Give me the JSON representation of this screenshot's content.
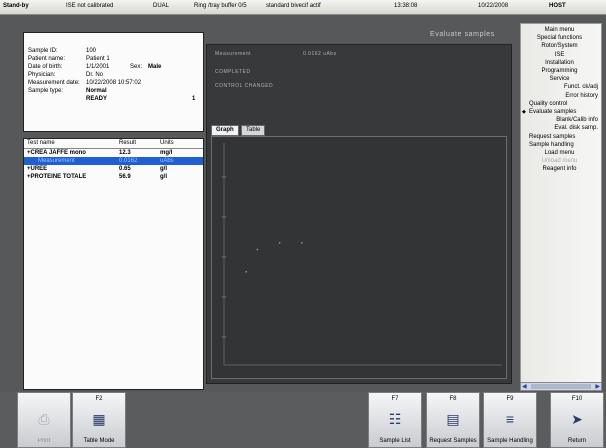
{
  "status_bar": {
    "state": "Stand-by",
    "ise": "ISE not calibrated",
    "mode": "DUAL",
    "ring": "Ring /tray buffer 0/5",
    "standard": "standard bivecif actif",
    "time": "13:38:08",
    "date": "10/22/2008",
    "host": "HOST"
  },
  "sample": {
    "id_label": "Sample ID:",
    "id_value": "100",
    "patient_label": "Patient name:",
    "patient_value": "Patient 1",
    "dob_label": "Date of birth:",
    "dob_value": "1/1/2001",
    "sex_label": "Sex:",
    "sex_value": "Male",
    "physician_label": "Physician:",
    "physician_value": "Dr. No",
    "measurement_label": "Measurement date:",
    "measurement_value": "10/22/2008 10:57:02",
    "type_label": "Sample type:",
    "type_value": "Normal",
    "status_value": "READY",
    "status_number": "1"
  },
  "results": {
    "headers": [
      "Test name",
      "Result",
      "Units"
    ],
    "rows": [
      {
        "name": "+CREA JAFFE mono",
        "result": "12.3",
        "units": "mg/l"
      },
      {
        "name": "Measurement",
        "result": "0.0162",
        "units": "uAbs"
      },
      {
        "name": "+UREE",
        "result": "0.65",
        "units": "g/l"
      },
      {
        "name": "+PROTEINE TOTALE",
        "result": "56.9",
        "units": "g/l"
      }
    ]
  },
  "display": {
    "measurement_label": "Measurement",
    "measurement_value": "0.0162 uAbs",
    "completed": "COMPLETED",
    "control": "CONTROL CHANGED",
    "tabs": [
      "Graph",
      "Table"
    ]
  },
  "evaluate_title": "Evaluate samples",
  "menu": [
    {
      "label": "Main menu",
      "level": "l2"
    },
    {
      "label": "Special functions",
      "level": "l2"
    },
    {
      "label": "Rotor/System",
      "level": "l2"
    },
    {
      "label": "ISE",
      "level": "l2"
    },
    {
      "label": "Installation",
      "level": "l2"
    },
    {
      "label": "Programming",
      "level": "l2"
    },
    {
      "label": "Service",
      "level": "l2"
    },
    {
      "label": "Funct. ck/adj",
      "level": "r"
    },
    {
      "label": "Error history",
      "level": "r"
    },
    {
      "label": "Quality control",
      "level": "l1"
    },
    {
      "label": "Evaluate samples",
      "level": "l1",
      "active": true
    },
    {
      "label": "Blank/Calib info",
      "level": "r"
    },
    {
      "label": "Eval. disk samp.",
      "level": "r"
    },
    {
      "label": "Request samples",
      "level": "l1"
    },
    {
      "label": "Sample handling",
      "level": "l1"
    },
    {
      "label": "Load menu",
      "level": "l2"
    },
    {
      "label": "Unload menu",
      "level": "l2",
      "disabled": true
    },
    {
      "label": "Reagent info",
      "level": "l2"
    }
  ],
  "fkeys": [
    {
      "key": "",
      "text": "Print",
      "icon": "printer-icon",
      "disabled": true
    },
    {
      "key": "F2",
      "text": "Table Mode",
      "icon": "table-icon"
    },
    {
      "key": "F7",
      "text": "Sample List",
      "icon": "clipboard-icon"
    },
    {
      "key": "F8",
      "text": "Request Samples",
      "icon": "rack-icon"
    },
    {
      "key": "F9",
      "text": "Sample Handling",
      "icon": "tubes-icon"
    },
    {
      "key": "F10",
      "text": "Return",
      "icon": "return-arrow-icon"
    }
  ],
  "colors": {
    "selected_row": "#1f5fd1",
    "display_bg": "#38393b"
  },
  "chart_data": {
    "type": "scatter",
    "points": [
      [
        0.08,
        0.42
      ],
      [
        0.12,
        0.52
      ],
      [
        0.2,
        0.55
      ],
      [
        0.28,
        0.55
      ]
    ]
  }
}
